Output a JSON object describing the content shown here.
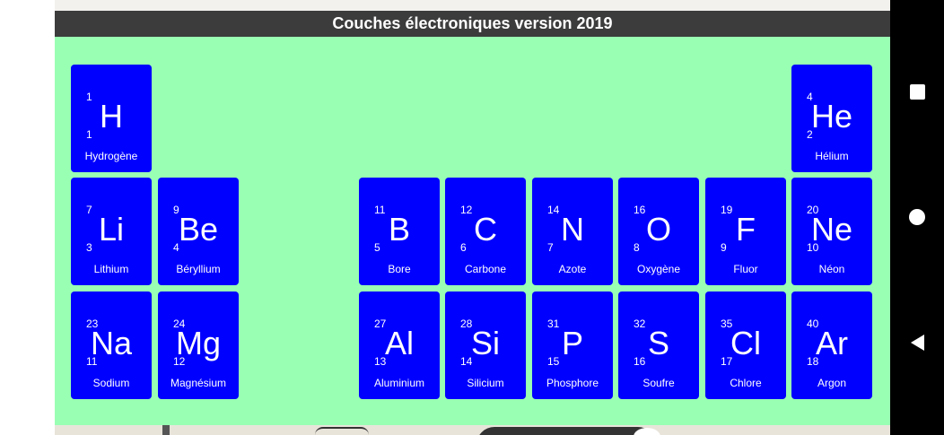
{
  "app": {
    "title": "Couches électroniques version 2019"
  },
  "colors": {
    "board": "#99ffb3",
    "tile": "#0000ff",
    "title_bar": "#3c3c3c"
  },
  "elements": [
    {
      "symbol": "H",
      "name": "Hydrogène",
      "mass": "1",
      "number": "1"
    },
    {
      "symbol": "He",
      "name": "Hélium",
      "mass": "4",
      "number": "2"
    },
    {
      "symbol": "Li",
      "name": "Lithium",
      "mass": "7",
      "number": "3"
    },
    {
      "symbol": "Be",
      "name": "Béryllium",
      "mass": "9",
      "number": "4"
    },
    {
      "symbol": "B",
      "name": "Bore",
      "mass": "11",
      "number": "5"
    },
    {
      "symbol": "C",
      "name": "Carbone",
      "mass": "12",
      "number": "6"
    },
    {
      "symbol": "N",
      "name": "Azote",
      "mass": "14",
      "number": "7"
    },
    {
      "symbol": "O",
      "name": "Oxygène",
      "mass": "16",
      "number": "8"
    },
    {
      "symbol": "F",
      "name": "Fluor",
      "mass": "19",
      "number": "9"
    },
    {
      "symbol": "Ne",
      "name": "Néon",
      "mass": "20",
      "number": "10"
    },
    {
      "symbol": "Na",
      "name": "Sodium",
      "mass": "23",
      "number": "11"
    },
    {
      "symbol": "Mg",
      "name": "Magnésium",
      "mass": "24",
      "number": "12"
    },
    {
      "symbol": "Al",
      "name": "Aluminium",
      "mass": "27",
      "number": "13"
    },
    {
      "symbol": "Si",
      "name": "Silicium",
      "mass": "28",
      "number": "14"
    },
    {
      "symbol": "P",
      "name": "Phosphore",
      "mass": "31",
      "number": "15"
    },
    {
      "symbol": "S",
      "name": "Soufre",
      "mass": "32",
      "number": "16"
    },
    {
      "symbol": "Cl",
      "name": "Chlore",
      "mass": "35",
      "number": "17"
    },
    {
      "symbol": "Ar",
      "name": "Argon",
      "mass": "40",
      "number": "18"
    }
  ],
  "nav": {
    "recents_icon": "square-icon",
    "home_icon": "circle-icon",
    "back_icon": "triangle-back-icon"
  }
}
